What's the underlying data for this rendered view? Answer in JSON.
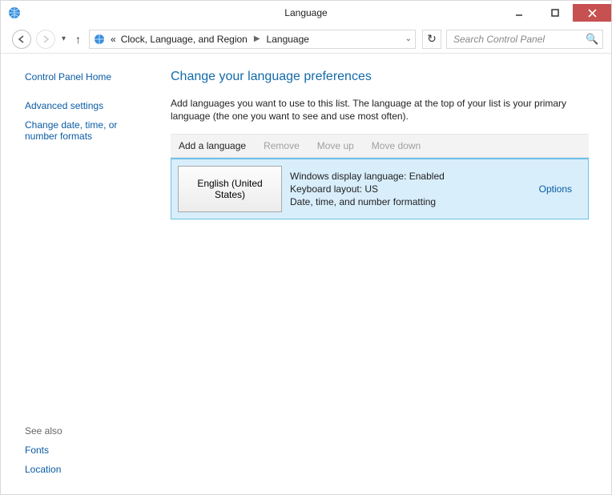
{
  "titlebar": {
    "title": "Language"
  },
  "breadcrumb": {
    "prefix": "«",
    "parent": "Clock, Language, and Region",
    "current": "Language"
  },
  "search": {
    "placeholder": "Search Control Panel"
  },
  "sidebar": {
    "home": "Control Panel Home",
    "links": {
      "advanced": "Advanced settings",
      "datefmt": "Change date, time, or number formats"
    },
    "seealso_label": "See also",
    "seealso": {
      "fonts": "Fonts",
      "location": "Location"
    }
  },
  "main": {
    "heading": "Change your language preferences",
    "description": "Add languages you want to use to this list. The language at the top of your list is your primary language (the one you want to see and use most often).",
    "toolbar": {
      "add": "Add a language",
      "remove": "Remove",
      "moveup": "Move up",
      "movedown": "Move down"
    },
    "languages": [
      {
        "name": "English (United States)",
        "detail1": "Windows display language: Enabled",
        "detail2": "Keyboard layout: US",
        "detail3": "Date, time, and number formatting",
        "options_label": "Options"
      }
    ]
  }
}
